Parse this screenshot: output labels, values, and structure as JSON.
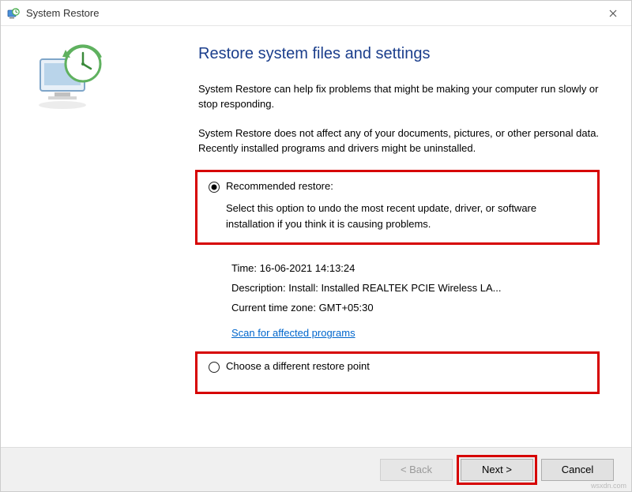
{
  "titlebar": {
    "title": "System Restore"
  },
  "heading": "Restore system files and settings",
  "para1": "System Restore can help fix problems that might be making your computer run slowly or stop responding.",
  "para2": "System Restore does not affect any of your documents, pictures, or other personal data. Recently installed programs and drivers might be uninstalled.",
  "option1": {
    "label": "Recommended restore:",
    "desc": "Select this option to undo the most recent update, driver, or software installation if you think it is causing problems."
  },
  "details": {
    "time_label": "Time:",
    "time_value": "16-06-2021 14:13:24",
    "desc_label": "Description:",
    "desc_value": "Install: Installed REALTEK PCIE Wireless LA...",
    "tz_label": "Current time zone:",
    "tz_value": "GMT+05:30"
  },
  "scan_link": "Scan for affected programs",
  "option2": {
    "label": "Choose a different restore point"
  },
  "buttons": {
    "back": "< Back",
    "next": "Next >",
    "cancel": "Cancel"
  },
  "watermark": "wsxdn.com"
}
